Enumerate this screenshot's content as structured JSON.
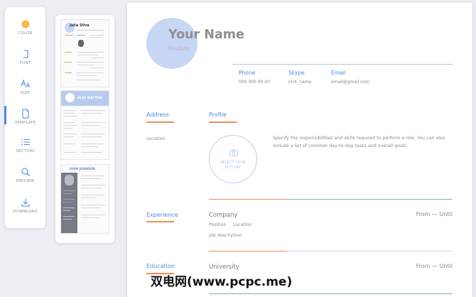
{
  "toolbar": {
    "items": [
      {
        "label": "COLOR",
        "icon": "color-dot-icon",
        "active": false
      },
      {
        "label": "FONT",
        "icon": "font-icon",
        "active": false
      },
      {
        "label": "SIZE",
        "icon": "size-icon",
        "active": false
      },
      {
        "label": "TEMPLATE",
        "icon": "template-icon",
        "active": true
      },
      {
        "label": "SECTION",
        "icon": "section-icon",
        "active": false
      },
      {
        "label": "PREVIEW",
        "icon": "preview-icon",
        "active": false
      },
      {
        "label": "DOWNLOAD",
        "icon": "download-icon",
        "active": false
      }
    ],
    "color_swatch": "#f5b84a",
    "accent": "#4b86e6"
  },
  "templates": [
    {
      "title": "Julia Silva",
      "header_color": "#c8d6f6"
    },
    {
      "title": "ALEX MATTEW",
      "header_color": "#b8cbee"
    },
    {
      "title": "JOHN JOHNSON",
      "header_color": "#777b85"
    }
  ],
  "resume": {
    "name": "Your Name",
    "position": "Position",
    "contacts": [
      {
        "label": "Phone",
        "value": "000 000 00 00"
      },
      {
        "label": "Skype",
        "value": "nick_name"
      },
      {
        "label": "Email",
        "value": "email@gmail.com"
      }
    ],
    "address": {
      "title": "Address",
      "value": "Location"
    },
    "profile": {
      "title": "Profile",
      "picture_placeholder": "SELECT YOUR PICTURE",
      "description": "Specify the responsibilities and skills required to perform a role. You can also include a list of common day-to-day tasks and overall goals."
    },
    "experience": {
      "title": "Experience",
      "company": "Company",
      "dates": "From — Until",
      "position": "Position",
      "location": "Location",
      "description": "Job description"
    },
    "education": {
      "title": "Education",
      "school": "University",
      "dates": "From — Until"
    }
  },
  "colors": {
    "accent_blue": "#4b86e6",
    "accent_orange": "#f08a53",
    "avatar_fill": "#c8d6f6",
    "divider_green": "#7ab89a"
  },
  "watermark": "双电网(www.pcpc.me)"
}
